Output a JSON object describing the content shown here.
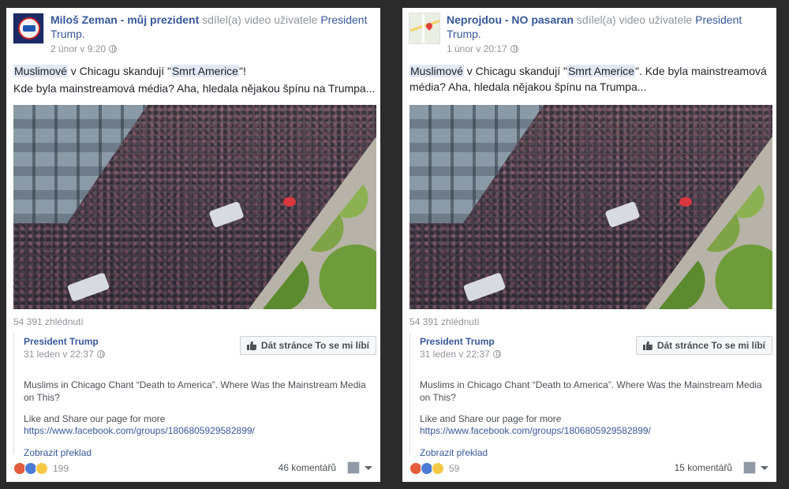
{
  "posts": [
    {
      "author": "Miloš Zeman - můj prezident",
      "shared_text": "sdílel(a) video uživatele",
      "shared_from": "President Trump.",
      "timestamp": "2 únor v 9:20",
      "message_tag": "Muslimové",
      "message_mid": "v Chicagu skandují \"",
      "message_tag2": "Smrt Americe",
      "message_end": "\"!",
      "message_line2": "Kde byla mainstreamová média? Aha, hledala nějakou špínu na Trumpa...",
      "views": "54 391 zhlédnutí",
      "attachment": {
        "page_name": "President Trump",
        "timestamp": "31 leden v 22:37",
        "like_button": "Dát stránce To se mi líbí",
        "description": "Muslims in Chicago Chant “Death to America”. Where Was the Mainstream Media on This?",
        "share_text": "Like and Share our page for more",
        "link": "https://www.facebook.com/groups/1806805929582899/",
        "translate": "Zobrazit překlad"
      },
      "reaction_count": "199",
      "comments": "46 komentářů"
    },
    {
      "author": "Neprojdou - NO pasaran",
      "shared_text": "sdílel(a) video uživatele",
      "shared_from": "President Trump.",
      "timestamp": "1 únor v 20:17",
      "message_tag": "Muslimové",
      "message_mid": "v Chicagu skandují \"",
      "message_tag2": "Smrt Americe",
      "message_end": "\". Kde byla mainstreamová média? Aha, hledala nějakou špínu na Trumpa...",
      "message_line2": "",
      "views": "54 391 zhlédnutí",
      "attachment": {
        "page_name": "President Trump",
        "timestamp": "31 leden v 22:37",
        "like_button": "Dát stránce To se mi líbí",
        "description": "Muslims in Chicago Chant “Death to America”. Where Was the Mainstream Media on This?",
        "share_text": "Like and Share our page for more",
        "link": "https://www.facebook.com/groups/1806805929582899/",
        "translate": "Zobrazit překlad"
      },
      "reaction_count": "59",
      "comments": "15 komentářů"
    }
  ]
}
